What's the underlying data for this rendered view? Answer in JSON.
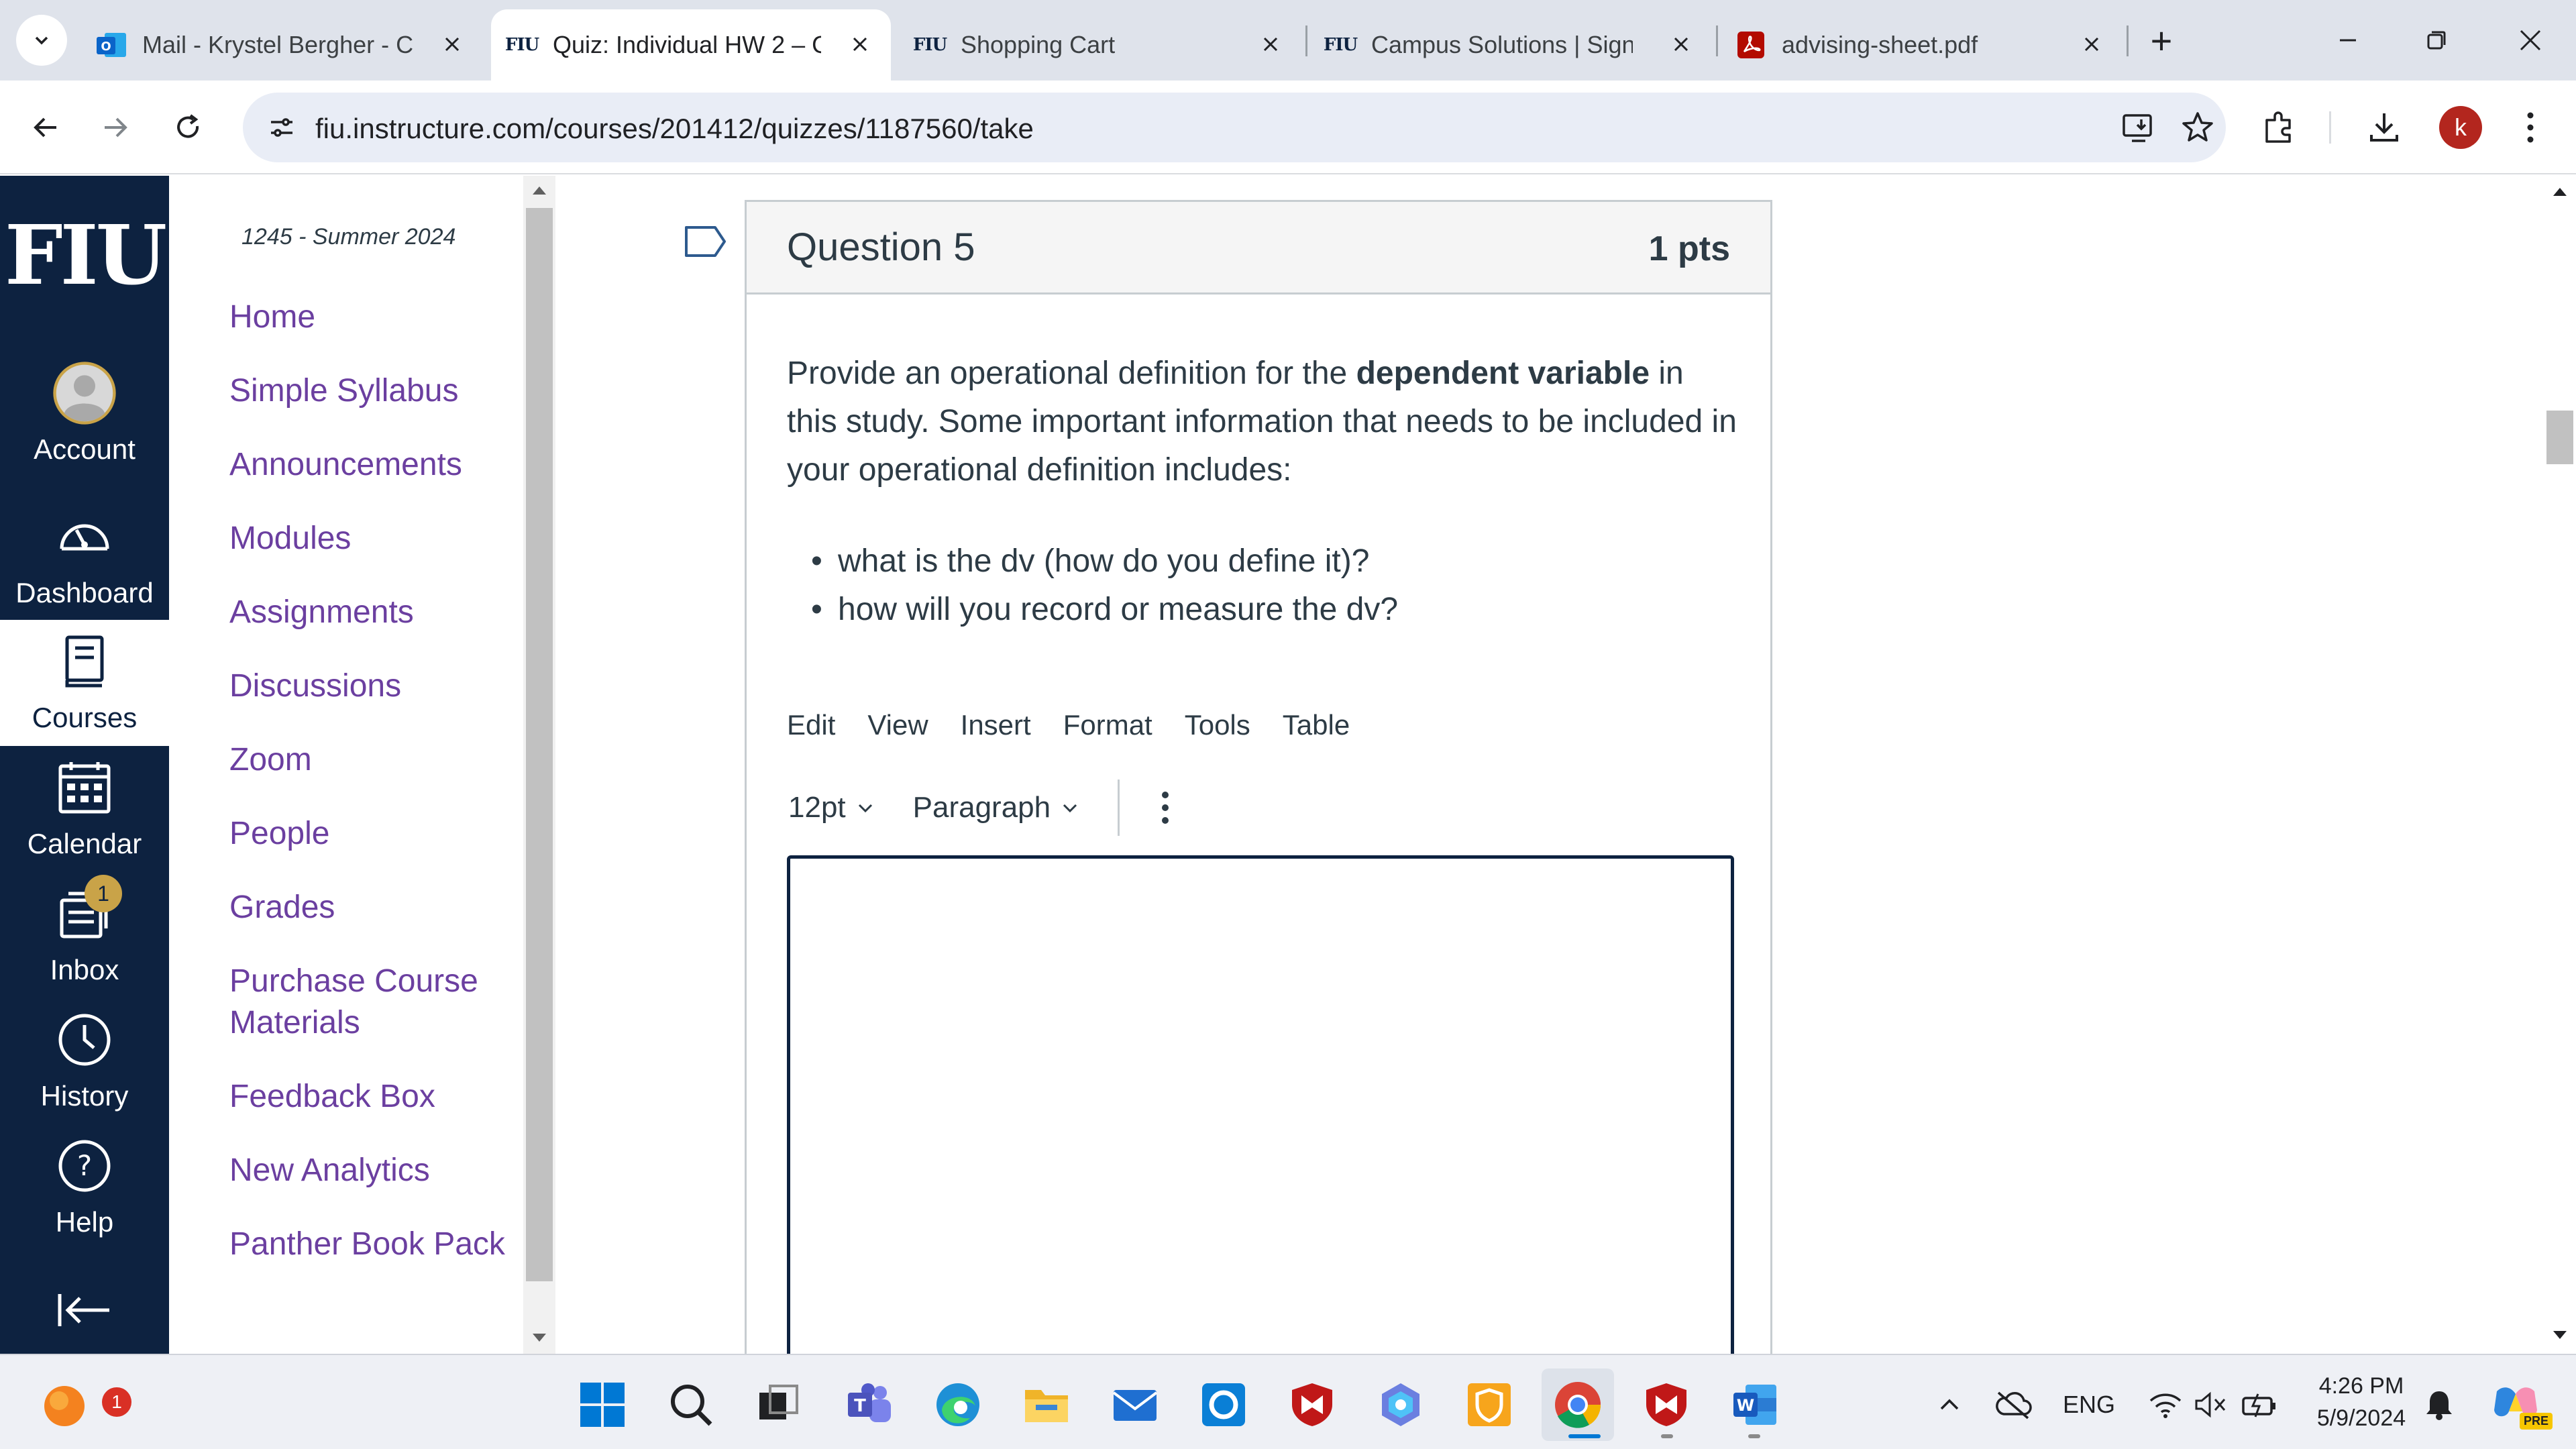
{
  "browser": {
    "tabs": [
      {
        "title": "Mail - Krystel Bergher - C",
        "favicon": "outlook-icon",
        "active": false
      },
      {
        "title": "Quiz: Individual HW 2 – C",
        "favicon": "FIU",
        "active": true
      },
      {
        "title": "Shopping Cart",
        "favicon": "FIU",
        "active": false
      },
      {
        "title": "Campus Solutions | Sign-",
        "favicon": "FIU",
        "active": false
      },
      {
        "title": "advising-sheet.pdf",
        "favicon": "pdf-icon",
        "active": false
      }
    ],
    "new_tab_label": "+",
    "url": "fiu.instructure.com/courses/201412/quizzes/1187560/take",
    "profile_initial": "k"
  },
  "global_nav": {
    "logo": "FIU",
    "items": [
      {
        "label": "Account",
        "icon": "account-avatar-icon"
      },
      {
        "label": "Dashboard",
        "icon": "dashboard-icon"
      },
      {
        "label": "Courses",
        "icon": "courses-icon",
        "active": true
      },
      {
        "label": "Calendar",
        "icon": "calendar-icon"
      },
      {
        "label": "Inbox",
        "icon": "inbox-icon",
        "badge": "1"
      },
      {
        "label": "History",
        "icon": "history-clock-icon"
      },
      {
        "label": "Help",
        "icon": "help-icon"
      }
    ],
    "collapse_icon": "collapse-arrow-icon"
  },
  "course_nav": {
    "term": "1245 - Summer 2024",
    "links": [
      "Home",
      "Simple Syllabus",
      "Announcements",
      "Modules",
      "Assignments",
      "Discussions",
      "Zoom",
      "People",
      "Grades",
      "Purchase Course Materials",
      "Feedback Box",
      "New Analytics",
      "Panther Book Pack"
    ]
  },
  "question": {
    "title": "Question 5",
    "points": "1 pts",
    "text_before": "Provide an operational definition for the ",
    "text_bold": "dependent variable",
    "text_after": " in this study. Some important information that needs to be included in your operational definition includes:",
    "bullets": [
      "what is the dv (how do you define it)?",
      "how will you record or measure the dv?"
    ]
  },
  "editor": {
    "menus": [
      "Edit",
      "View",
      "Insert",
      "Format",
      "Tools",
      "Table"
    ],
    "font_size": "12pt",
    "block_format": "Paragraph",
    "more_icon": "more-vertical-icon",
    "content": ""
  },
  "taskbar": {
    "notification_count": "1",
    "apps": [
      "windows-start-icon",
      "search-icon",
      "task-view-icon",
      "teams-icon",
      "edge-icon",
      "file-explorer-icon",
      "mail-icon",
      "cortana-icon",
      "mcafee-icon",
      "copilot-icon",
      "security-shield-icon",
      "chrome-icon",
      "mcafee-icon",
      "word-icon"
    ],
    "language": "ENG",
    "time": "4:26 PM",
    "date": "5/9/2024",
    "copilot_badge": "PRE"
  },
  "colors": {
    "canvas_navy": "#0d2240",
    "link_purple": "#6b3fa0",
    "tab_strip": "#dfe3eb",
    "omnibox": "#e9edf6",
    "profile_red": "#b3261e",
    "badge_gold": "#c9a348"
  }
}
